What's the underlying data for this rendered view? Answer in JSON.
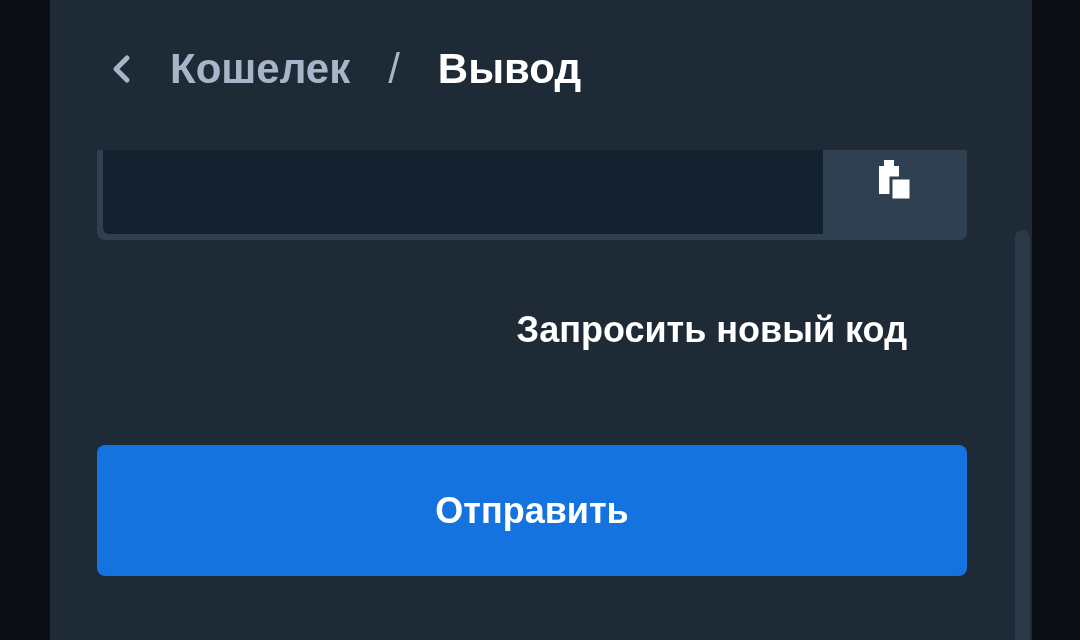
{
  "breadcrumb": {
    "parent": "Кошелек",
    "separator": "/",
    "current": "Вывод"
  },
  "resend_link": "Запросить новый код",
  "submit_button": "Отправить"
}
